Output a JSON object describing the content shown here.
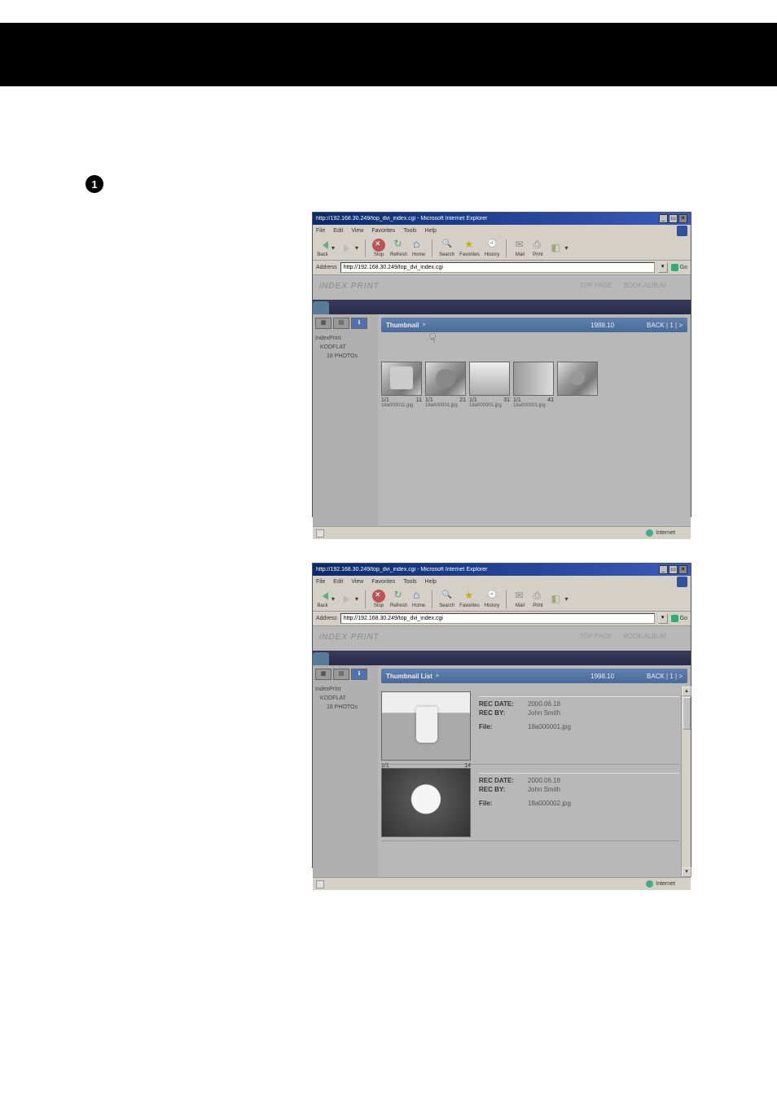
{
  "page": {
    "bullet1": "1"
  },
  "browser": {
    "title": "http://192.168.30.249/top_dvi_index.cgi - Microsoft Internet Explorer",
    "menus": {
      "file": "File",
      "edit": "Edit",
      "view": "View",
      "favorites": "Favorites",
      "tools": "Tools",
      "help": "Help"
    },
    "toolbar": {
      "back": "Back",
      "forward": "",
      "stop": "Stop",
      "refresh": "Refresh",
      "home": "Home",
      "search": "Search",
      "favorites": "Favorites",
      "history": "History",
      "mail": "Mail",
      "print": "Print"
    },
    "address_label": "Address",
    "address_value": "http://192.168.30.249/top_dvi_index.cgi",
    "go": "Go",
    "status_left": "",
    "status_zone": "Internet"
  },
  "app": {
    "product": "iNDEX PRINT",
    "top_links": {
      "top": "TOP PAGE",
      "book": "BOOK ALBUM"
    },
    "tabs": {
      "tab1": "",
      "tab2": ""
    },
    "tree": {
      "view_thumb": "▦",
      "view_list": "▤",
      "view_info": "ℹ",
      "line1": "IndexPrint",
      "line2": "KODFLAT",
      "line3": "18 PHOTOs"
    },
    "listHeader": {
      "title": "Thumbnail",
      "titleList": "Thumbnail List",
      "nav": ">",
      "date": "1998.10",
      "pagenav": "BACK | 1 | >"
    }
  },
  "thumbs": [
    {
      "seq": "1/1",
      "num": "11",
      "file": "18a000011.jpg"
    },
    {
      "seq": "1/1",
      "num": "21",
      "file": "18a000001.jpg"
    },
    {
      "seq": "1/1",
      "num": "31",
      "file": "18a000001.jpg"
    },
    {
      "seq": "1/1",
      "num": "41",
      "file": "18a000001.jpg"
    },
    {
      "seq": "",
      "num": "",
      "file": ""
    }
  ],
  "details": [
    {
      "seq": "1/1",
      "thumbnum": "14",
      "rows": {
        "recdate_label": "REC DATE:",
        "recdate_value": "2000.06.18",
        "recby_label": "REC BY:",
        "recby_value": "John Smith",
        "file_label": "File:",
        "file_value": "18a000001.jpg"
      }
    },
    {
      "seq": "",
      "thumbnum": "",
      "rows": {
        "recdate_label": "REC DATE:",
        "recdate_value": "2000.06.18",
        "recby_label": "REC BY:",
        "recby_value": "John Smith",
        "file_label": "File:",
        "file_value": "18a000002.jpg"
      }
    }
  ]
}
